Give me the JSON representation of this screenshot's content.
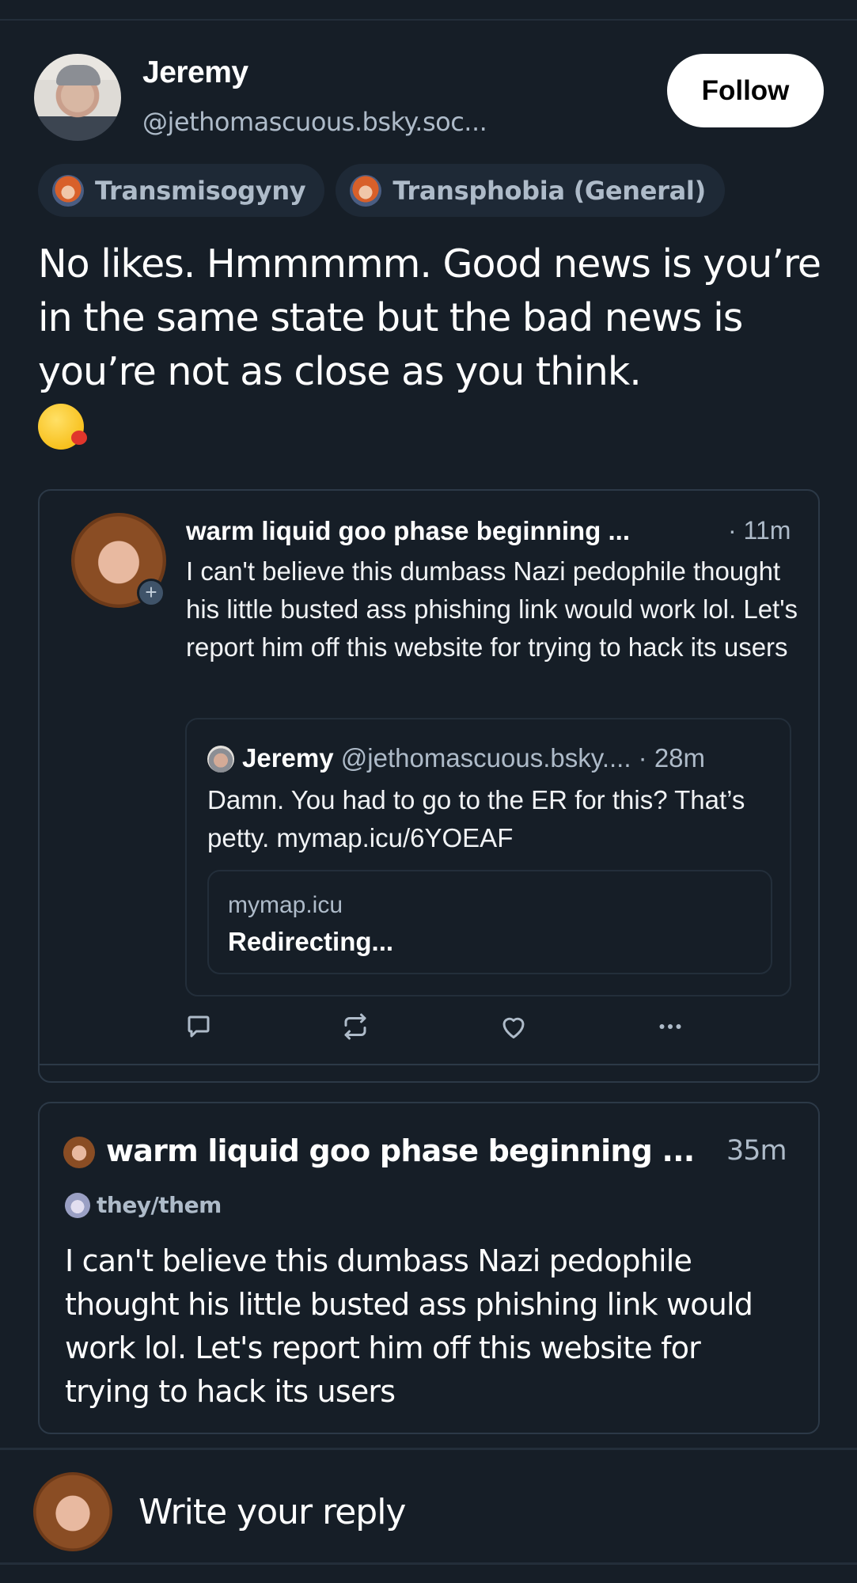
{
  "post": {
    "author": {
      "display_name": "Jeremy",
      "handle": "@jethomascuous.bsky.soc...",
      "avatar_icon": "user-avatar-photo"
    },
    "follow_label": "Follow",
    "labels": [
      {
        "text": "Transmisogyny",
        "icon": "labeler-avatar"
      },
      {
        "text": "Transphobia (General)",
        "icon": "labeler-avatar"
      }
    ],
    "text": "No likes. Hmmmmm.  Good news is you’re in the same state but the bad news is you’re not as close as you think.",
    "emoji": "😘",
    "emoji_icon": "face-blowing-kiss-emoji"
  },
  "quoted_post": {
    "author_name": "warm liquid goo phase beginning ...",
    "time": "· 11m",
    "text": "I can't believe this dumbass Nazi pedophile thought his little busted ass phishing link would work lol. Let's report him off this website for trying to hack its users",
    "follow_badge": "+",
    "nested_quote": {
      "author_name": "Jeremy",
      "handle": "@jethomascuous.bsky....",
      "time": "· 28m",
      "text": "Damn. You had to go to the ER for this? That’s petty. mymap.icu/6YOEAF",
      "link_card": {
        "domain": "mymap.icu",
        "title": "Redirecting..."
      }
    },
    "actions": [
      {
        "name": "reply",
        "icon": "reply-bubble-icon"
      },
      {
        "name": "repost",
        "icon": "repost-icon"
      },
      {
        "name": "like",
        "icon": "heart-icon"
      },
      {
        "name": "more",
        "icon": "more-dots-icon"
      }
    ]
  },
  "reply_post": {
    "author_name": "warm liquid goo phase beginning ...",
    "time": "35m",
    "pronouns": "they/them",
    "text": "I can't believe this dumbass Nazi pedophile thought his little busted ass phishing link would work lol. Let's report him off this website for trying to hack its users"
  },
  "composer": {
    "placeholder": "Write your reply"
  },
  "colors": {
    "background": "#161e27",
    "chip_background": "#1e2936",
    "muted_text": "#aebbc9",
    "border": "#2c3947",
    "follow_button": "#ffffff"
  }
}
